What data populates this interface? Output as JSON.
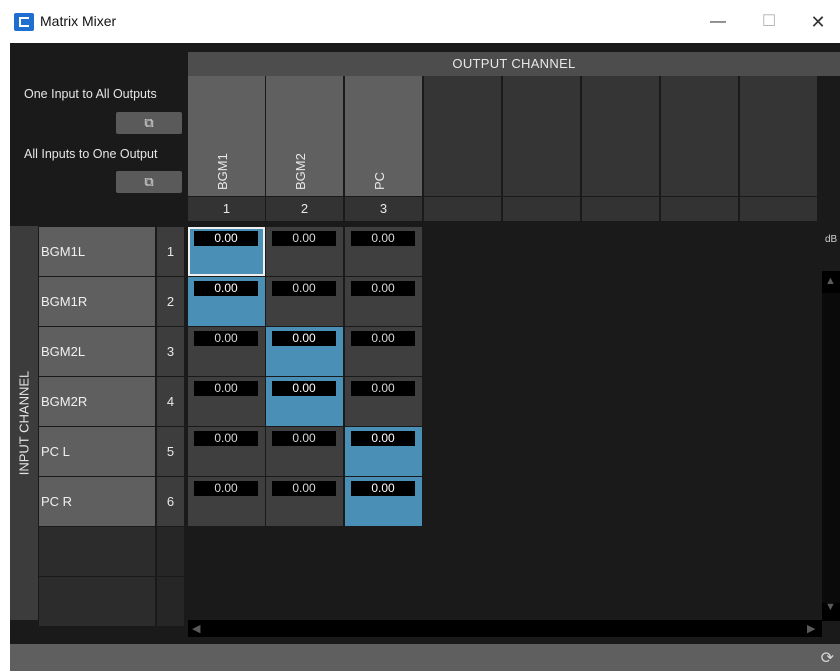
{
  "window": {
    "title": "Matrix Mixer",
    "minimize": "—",
    "maximize": "☐",
    "close": "✕"
  },
  "controls": {
    "one_to_all_label": "One Input to All Outputs",
    "all_to_one_label": "All Inputs to One Output",
    "popout_glyph": "⧉"
  },
  "output": {
    "header": "OUTPUT CHANNEL",
    "channels": [
      {
        "name": "BGM1",
        "num": "1"
      },
      {
        "name": "BGM2",
        "num": "2"
      },
      {
        "name": "PC",
        "num": "3"
      },
      {
        "name": "",
        "num": ""
      },
      {
        "name": "",
        "num": ""
      },
      {
        "name": "",
        "num": ""
      },
      {
        "name": "",
        "num": ""
      },
      {
        "name": "",
        "num": ""
      }
    ]
  },
  "input": {
    "header": "INPUT CHANNEL",
    "channels": [
      {
        "name": "BGM1L",
        "num": "1"
      },
      {
        "name": "BGM1R",
        "num": "2"
      },
      {
        "name": "BGM2L",
        "num": "3"
      },
      {
        "name": "BGM2R",
        "num": "4"
      },
      {
        "name": "PC L",
        "num": "5"
      },
      {
        "name": "PC R",
        "num": "6"
      },
      {
        "name": "",
        "num": ""
      },
      {
        "name": "",
        "num": ""
      }
    ]
  },
  "matrix": {
    "values": [
      [
        "0.00",
        "0.00",
        "0.00"
      ],
      [
        "0.00",
        "0.00",
        "0.00"
      ],
      [
        "0.00",
        "0.00",
        "0.00"
      ],
      [
        "0.00",
        "0.00",
        "0.00"
      ],
      [
        "0.00",
        "0.00",
        "0.00"
      ],
      [
        "0.00",
        "0.00",
        "0.00"
      ]
    ],
    "on": [
      [
        true,
        false,
        false
      ],
      [
        true,
        false,
        false
      ],
      [
        false,
        true,
        false
      ],
      [
        false,
        true,
        false
      ],
      [
        false,
        false,
        true
      ],
      [
        false,
        false,
        true
      ]
    ],
    "selected": [
      0,
      0
    ],
    "unit": "dB"
  },
  "colors": {
    "cell_on": "#4a8fb5",
    "cell_off": "#3f3f3f",
    "background": "#1a1a1a"
  },
  "icons": {
    "refresh": "refresh-icon",
    "popout": "popout-icon"
  }
}
